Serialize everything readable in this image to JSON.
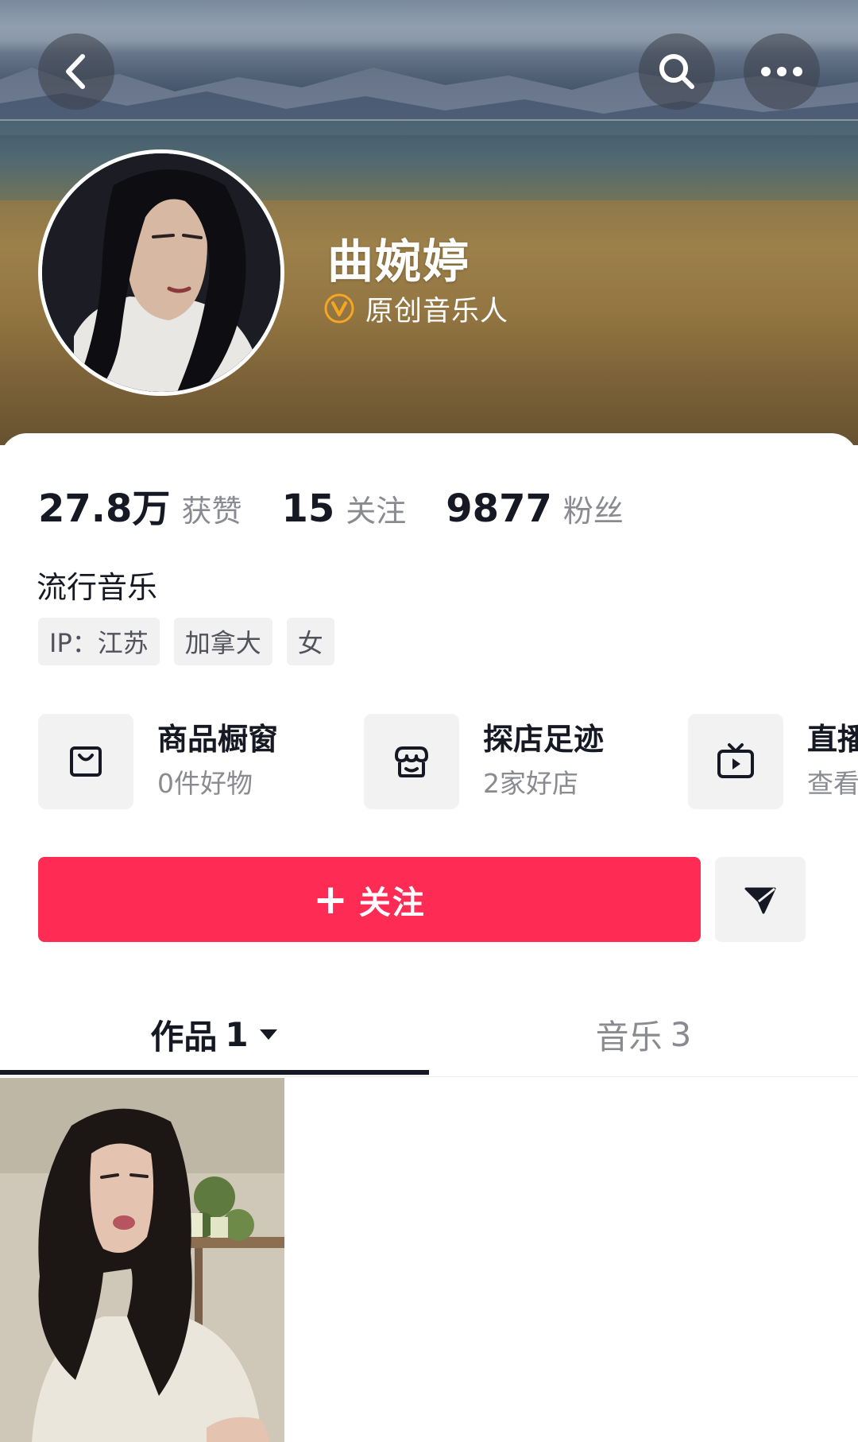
{
  "header": {
    "back_icon": "chevron-left-icon",
    "search_icon": "search-icon",
    "more_icon": "more-horizontal-icon"
  },
  "profile": {
    "name": "曲婉婷",
    "verified_label": "原创音乐人",
    "verified_badge_color": "#f5a623"
  },
  "stats": [
    {
      "value": "27.8万",
      "label": "获赞"
    },
    {
      "value": "15",
      "label": "关注"
    },
    {
      "value": "9877",
      "label": "粉丝"
    }
  ],
  "bio": "流行音乐",
  "tags": [
    "IP：江苏",
    "加拿大",
    "女"
  ],
  "services": [
    {
      "icon": "shopping-bag-icon",
      "title": "商品橱窗",
      "subtitle": "0件好物"
    },
    {
      "icon": "store-icon",
      "title": "探店足迹",
      "subtitle": "2家好店"
    },
    {
      "icon": "tv-play-icon",
      "title": "直播",
      "subtitle": "查看"
    }
  ],
  "actions": {
    "follow_label": "关注",
    "follow_color": "#fe2c55",
    "share_icon": "send-icon"
  },
  "tabs": [
    {
      "label": "作品",
      "count": "1",
      "active": true
    },
    {
      "label": "音乐",
      "count": "3",
      "active": false
    }
  ]
}
